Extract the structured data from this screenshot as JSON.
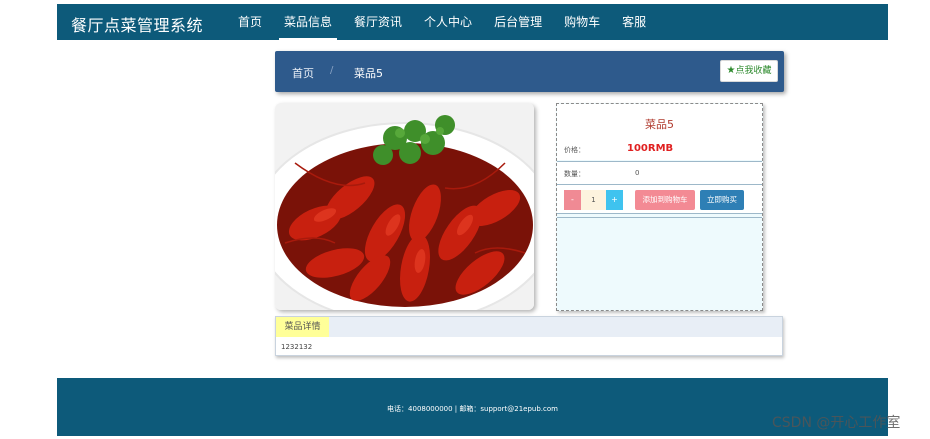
{
  "header": {
    "brand": "餐厅点菜管理系统",
    "nav": [
      {
        "label": "首页",
        "active": false
      },
      {
        "label": "菜品信息",
        "active": true
      },
      {
        "label": "餐厅资讯",
        "active": false
      },
      {
        "label": "个人中心",
        "active": false
      },
      {
        "label": "后台管理",
        "active": false
      },
      {
        "label": "购物车",
        "active": false
      },
      {
        "label": "客服",
        "active": false
      }
    ]
  },
  "breadcrumb": {
    "home": "首页",
    "separator": "/",
    "current": "菜品5",
    "favorite_label": "点我收藏",
    "favorite_icon": "star-icon"
  },
  "product": {
    "name": "菜品5",
    "price_label": "价格：",
    "price": "100RMB",
    "qty_label": "数量：",
    "stock": "0",
    "quantity": "1",
    "minus": "-",
    "plus": "+",
    "add_to_cart": "添加到购物车",
    "buy_now": "立即购买"
  },
  "details": {
    "tab": "菜品详情",
    "content": "1232132"
  },
  "footer": {
    "text": "电话：4008000000 | 邮箱：support@21epub.com"
  },
  "watermark": "CSDN @开心工作室",
  "colors": {
    "nav_bg": "#0d5a7a",
    "crumb_bg": "#2e5a8c",
    "price": "#e02020",
    "add_cart": "#f38a94",
    "buy_now": "#2e7fb5"
  }
}
